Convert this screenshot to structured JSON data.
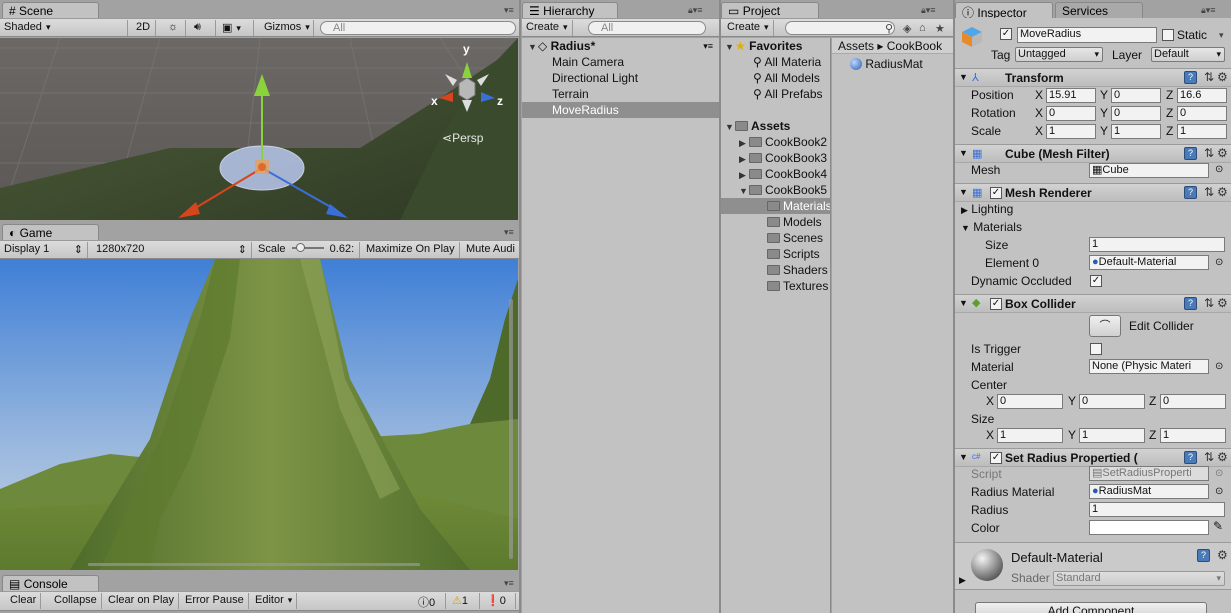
{
  "scene": {
    "tab": "Scene",
    "shading": "Shaded",
    "mode2d": "2D",
    "gizmos": "Gizmos",
    "search_placeholder": "All",
    "persp": "Persp",
    "axis_y": "y",
    "axis_x": "x",
    "axis_z": "z"
  },
  "game": {
    "tab": "Game",
    "display": "Display 1",
    "resolution": "1280x720",
    "scale_label": "Scale",
    "scale_value": "0.62:",
    "maximize": "Maximize On Play",
    "mute": "Mute Audi"
  },
  "console": {
    "tab": "Console",
    "clear": "Clear",
    "collapse": "Collapse",
    "clear_on_play": "Clear on Play",
    "error_pause": "Error Pause",
    "editor": "Editor",
    "info_count": "0",
    "warn_count": "1",
    "error_count": "0"
  },
  "hierarchy": {
    "tab": "Hierarchy",
    "create": "Create",
    "search_placeholder": "All",
    "scene_name": "Radius*",
    "items": [
      "Main Camera",
      "Directional Light",
      "Terrain",
      "MoveRadius"
    ]
  },
  "project": {
    "tab": "Project",
    "create": "Create",
    "favorites": "Favorites",
    "fav_items": [
      "All Materia",
      "All Models",
      "All Prefabs"
    ],
    "assets": "Assets",
    "folders": [
      "CookBook2",
      "CookBook3",
      "CookBook4",
      "CookBook5"
    ],
    "sub_folders": [
      "Materials",
      "Models",
      "Scenes",
      "Scripts",
      "Shaders",
      "Textures"
    ],
    "breadcrumb": [
      "Assets",
      "CookBook"
    ],
    "files": [
      "RadiusMat"
    ]
  },
  "inspector": {
    "tab": "Inspector",
    "tab2": "Services",
    "object_name": "MoveRadius",
    "static_label": "Static",
    "tag_label": "Tag",
    "tag_value": "Untagged",
    "layer_label": "Layer",
    "layer_value": "Default",
    "transform": {
      "title": "Transform",
      "position_label": "Position",
      "rotation_label": "Rotation",
      "scale_label": "Scale",
      "position": [
        "15.91",
        "0",
        "16.6"
      ],
      "rotation": [
        "0",
        "0",
        "0"
      ],
      "scale": [
        "1",
        "1",
        "1"
      ]
    },
    "mesh_filter": {
      "title": "Cube (Mesh Filter)",
      "mesh_label": "Mesh",
      "mesh_value": "Cube"
    },
    "mesh_renderer": {
      "title": "Mesh Renderer",
      "lighting": "Lighting",
      "materials": "Materials",
      "size_label": "Size",
      "size_value": "1",
      "element0_label": "Element 0",
      "element0_value": "Default-Material",
      "dynamic_occluded": "Dynamic Occluded"
    },
    "box_collider": {
      "title": "Box Collider",
      "edit_collider": "Edit Collider",
      "is_trigger": "Is Trigger",
      "material_label": "Material",
      "material_value": "None (Physic Materi",
      "center_label": "Center",
      "center": [
        "0",
        "0",
        "0"
      ],
      "size_label": "Size",
      "size": [
        "1",
        "1",
        "1"
      ]
    },
    "script_comp": {
      "title": "Set Radius Propertied (",
      "script_label": "Script",
      "script_value": "SetRadiusProperti",
      "radius_material_label": "Radius Material",
      "radius_material_value": "RadiusMat",
      "radius_label": "Radius",
      "radius_value": "1",
      "color_label": "Color"
    },
    "material": {
      "name": "Default-Material",
      "shader_label": "Shader",
      "shader_value": "Standard"
    },
    "add_component": "Add Component"
  }
}
